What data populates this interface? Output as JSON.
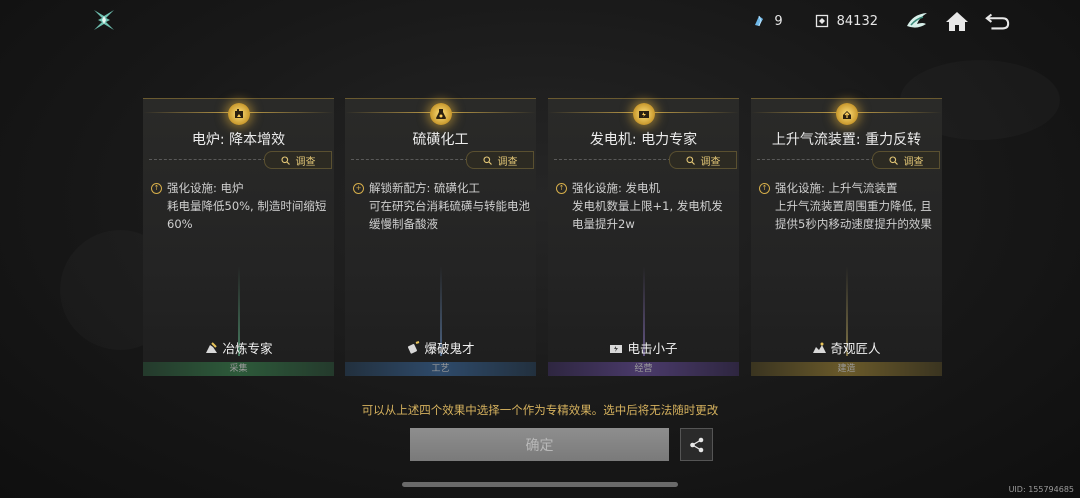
{
  "topbar": {
    "resource1_value": "9",
    "resource2_value": "84132"
  },
  "colors": {
    "gold": "#d6b25e",
    "cat_gather": "#2d5a3a",
    "cat_craft": "#2e4a6a",
    "cat_manage": "#4a3a6a",
    "cat_build": "#6a5a2a"
  },
  "cards": [
    {
      "title": "电炉: 降本增效",
      "survey_label": "调查",
      "desc_head": "强化设施: 电炉",
      "desc_body": "耗电量降低50%, 制造时间缩短60%",
      "badge": "冶炼专家",
      "category": "采集",
      "icon": "furnace-icon",
      "bullet": "up"
    },
    {
      "title": "硫磺化工",
      "survey_label": "调查",
      "desc_head": "解锁新配方: 硫磺化工",
      "desc_body": "可在研究台消耗硫磺与转能电池缓慢制备酸液",
      "badge": "爆破鬼才",
      "category": "工艺",
      "icon": "flask-icon",
      "bullet": "plus"
    },
    {
      "title": "发电机: 电力专家",
      "survey_label": "调查",
      "desc_head": "强化设施: 发电机",
      "desc_body": "发电机数量上限+1, 发电机发电量提升2w",
      "badge": "电击小子",
      "category": "经营",
      "icon": "generator-icon",
      "bullet": "up"
    },
    {
      "title": "上升气流装置: 重力反转",
      "survey_label": "调查",
      "desc_head": "强化设施: 上升气流装置",
      "desc_body": "上升气流装置周围重力降低, 且提供5秒内移动速度提升的效果",
      "badge": "奇观匠人",
      "category": "建造",
      "icon": "updraft-icon",
      "bullet": "up"
    }
  ],
  "hint": "可以从上述四个效果中选择一个作为专精效果。选中后将无法随时更改",
  "confirm_label": "确定",
  "uid": "UID: 155794685"
}
